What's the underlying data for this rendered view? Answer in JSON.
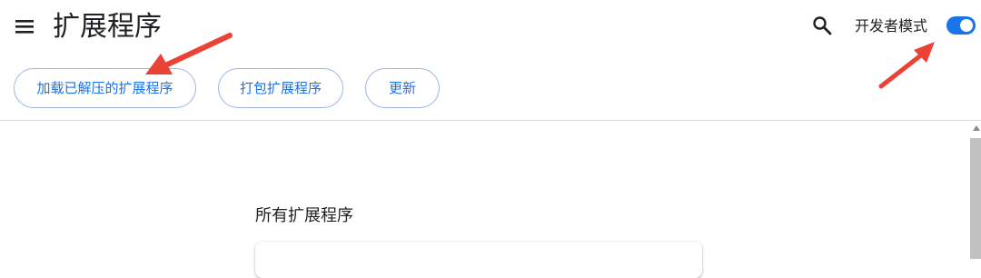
{
  "header": {
    "title": "扩展程序",
    "dev_mode_label": "开发者模式",
    "dev_mode_enabled": true,
    "icons": {
      "menu": "hamburger-menu-icon",
      "search": "search-icon"
    }
  },
  "toolbar": {
    "load_unpacked_label": "加载已解压的扩展程序",
    "pack_extension_label": "打包扩展程序",
    "update_label": "更新"
  },
  "main": {
    "section_heading": "所有扩展程序"
  },
  "colors": {
    "accent": "#1a73e8",
    "annotation_arrow": "#ea4335",
    "button_border": "#9ab7e6"
  }
}
